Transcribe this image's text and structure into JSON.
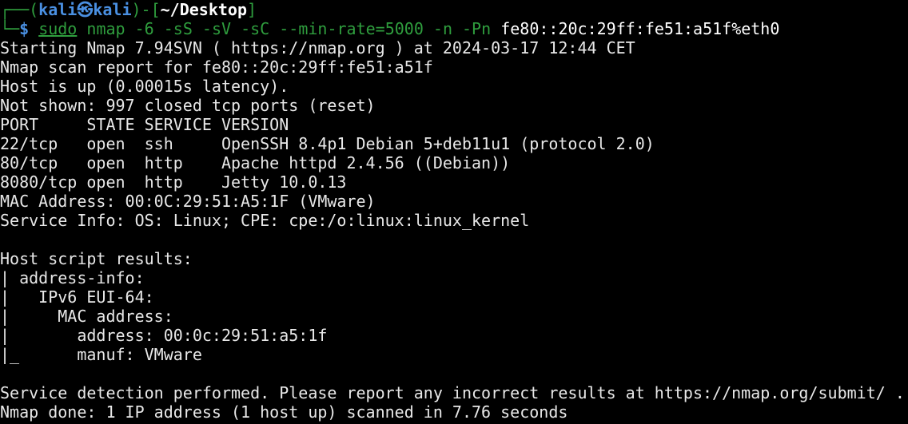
{
  "prompt": {
    "frame_top": "┌──(",
    "user": "kali",
    "at_symbol": "㉿",
    "host": "kali",
    "frame_mid": ")-[",
    "path": "~/Desktop",
    "frame_close": "]",
    "frame_bottom": "└─",
    "dollar": "$",
    "cmd_sudo": "sudo",
    "cmd_nmap": "nmap",
    "cmd_args": "-6 -sS -sV -sC --min-rate=5000 -n -Pn",
    "cmd_target": "fe80::20c:29ff:fe51:a51f%eth0"
  },
  "output": {
    "start": "Starting Nmap 7.94SVN ( https://nmap.org ) at 2024-03-17 12:44 CET",
    "report": "Nmap scan report for fe80::20c:29ff:fe51:a51f",
    "host_up": "Host is up (0.00015s latency).",
    "not_shown": "Not shown: 997 closed tcp ports (reset)",
    "port_header": "PORT     STATE SERVICE VERSION",
    "ports": [
      "22/tcp   open  ssh     OpenSSH 8.4p1 Debian 5+deb11u1 (protocol 2.0)",
      "80/tcp   open  http    Apache httpd 2.4.56 ((Debian))",
      "8080/tcp open  http    Jetty 10.0.13"
    ],
    "mac": "MAC Address: 00:0C:29:51:A5:1F (VMware)",
    "service_info": "Service Info: OS: Linux; CPE: cpe:/o:linux:linux_kernel",
    "host_script_header": "Host script results:",
    "script_lines": [
      "| address-info:",
      "|   IPv6 EUI-64:",
      "|     MAC address:",
      "|       address: 00:0c:29:51:a5:1f",
      "|_      manuf: VMware"
    ],
    "service_detection": "Service detection performed. Please report any incorrect results at https://nmap.org/submit/ .",
    "done": "Nmap done: 1 IP address (1 host up) scanned in 7.76 seconds"
  }
}
